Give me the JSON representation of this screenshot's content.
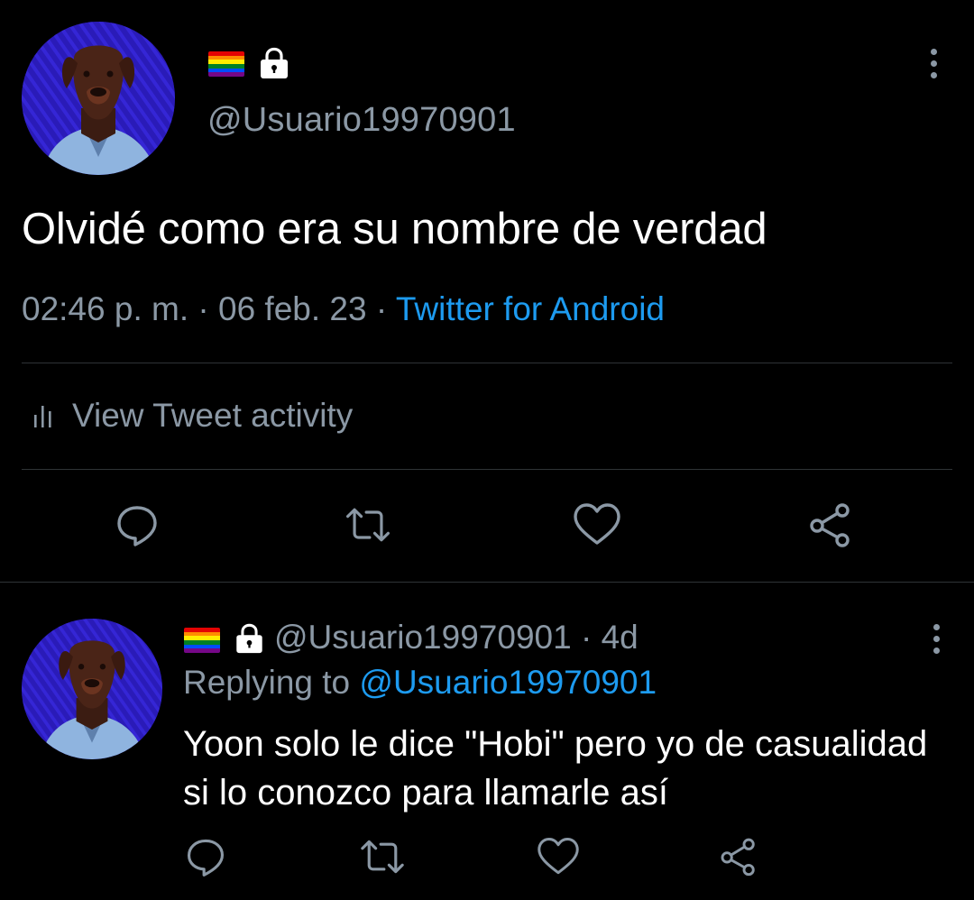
{
  "tweet": {
    "handle": "@Usuario19970901",
    "text": "Olvidé como era su nombre de verdad",
    "time": "02:46 p. m.",
    "separator": " · ",
    "date": "06 feb. 23",
    "source": "Twitter for Android",
    "activity_label": "View Tweet activity",
    "badges": [
      "rainbow-flag-icon",
      "lock-icon"
    ]
  },
  "reply": {
    "handle": "@Usuario19970901",
    "age": "4d",
    "header_sep": " · ",
    "replying_prefix": "Replying to ",
    "replying_to": "@Usuario19970901",
    "text": "Yoon solo le dice \"Hobi\" pero yo de casualidad si lo conozco para llamarle así"
  },
  "actions": [
    "reply-icon",
    "retweet-icon",
    "like-icon",
    "share-icon"
  ],
  "colors": {
    "background": "#000000",
    "text_primary": "#ffffff",
    "text_secondary": "#8b98a5",
    "link": "#1d9bf0",
    "divider": "#2f3336",
    "avatar_bg": "#2413a8"
  }
}
